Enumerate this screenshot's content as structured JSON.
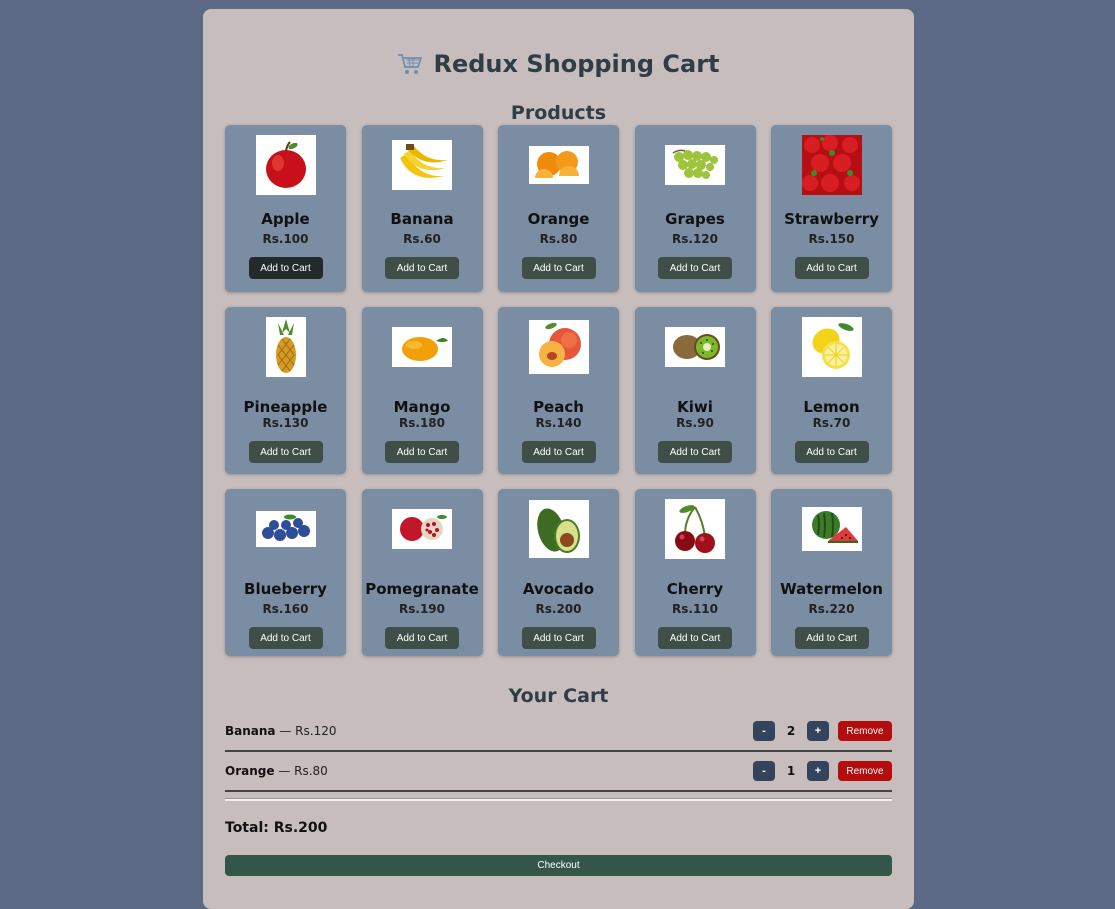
{
  "app": {
    "title": "Redux Shopping Cart",
    "products_heading": "Products",
    "cart_heading": "Your Cart"
  },
  "products": [
    {
      "name": "Apple",
      "price": "Rs.100",
      "button": "Add to Cart",
      "image": "apple-image"
    },
    {
      "name": "Banana",
      "price": "Rs.60",
      "button": "Add to Cart",
      "image": "banana-image"
    },
    {
      "name": "Orange",
      "price": "Rs.80",
      "button": "Add to Cart",
      "image": "orange-image"
    },
    {
      "name": "Grapes",
      "price": "Rs.120",
      "button": "Add to Cart",
      "image": "grapes-image"
    },
    {
      "name": "Strawberry",
      "price": "Rs.150",
      "button": "Add to Cart",
      "image": "strawberry-image"
    },
    {
      "name": "Pineapple",
      "price": "Rs.130",
      "button": "Add to Cart",
      "image": "pineapple-image"
    },
    {
      "name": "Mango",
      "price": "Rs.180",
      "button": "Add to Cart",
      "image": "mango-image"
    },
    {
      "name": "Peach",
      "price": "Rs.140",
      "button": "Add to Cart",
      "image": "peach-image"
    },
    {
      "name": "Kiwi",
      "price": "Rs.90",
      "button": "Add to Cart",
      "image": "kiwi-image"
    },
    {
      "name": "Lemon",
      "price": "Rs.70",
      "button": "Add to Cart",
      "image": "lemon-image"
    },
    {
      "name": "Blueberry",
      "price": "Rs.160",
      "button": "Add to Cart",
      "image": "blueberry-image"
    },
    {
      "name": "Pomegranate",
      "price": "Rs.190",
      "button": "Add to Cart",
      "image": "pomegranate-image"
    },
    {
      "name": "Avocado",
      "price": "Rs.200",
      "button": "Add to Cart",
      "image": "avocado-image"
    },
    {
      "name": "Cherry",
      "price": "Rs.110",
      "button": "Add to Cart",
      "image": "cherry-image"
    },
    {
      "name": "Watermelon",
      "price": "Rs.220",
      "button": "Add to Cart",
      "image": "watermelon-image"
    }
  ],
  "cart": {
    "items": [
      {
        "name": "Banana",
        "separator": " — ",
        "price": "Rs.120",
        "qty": "2",
        "minus": "-",
        "plus": "+",
        "remove": "Remove"
      },
      {
        "name": "Orange",
        "separator": " — ",
        "price": "Rs.80",
        "qty": "1",
        "minus": "-",
        "plus": "+",
        "remove": "Remove"
      }
    ],
    "total": "Total: Rs.200",
    "checkout": "Checkout"
  },
  "colors": {
    "background": "#5b6985",
    "panel": "#c7bdbd",
    "card": "#7b8da2",
    "add_button": "#3f4e47",
    "remove_button": "#b30d0d",
    "qty_button": "#34445c",
    "checkout_button": "#34564a"
  },
  "icons": {
    "title_icon": "shopping-cart-icon"
  }
}
